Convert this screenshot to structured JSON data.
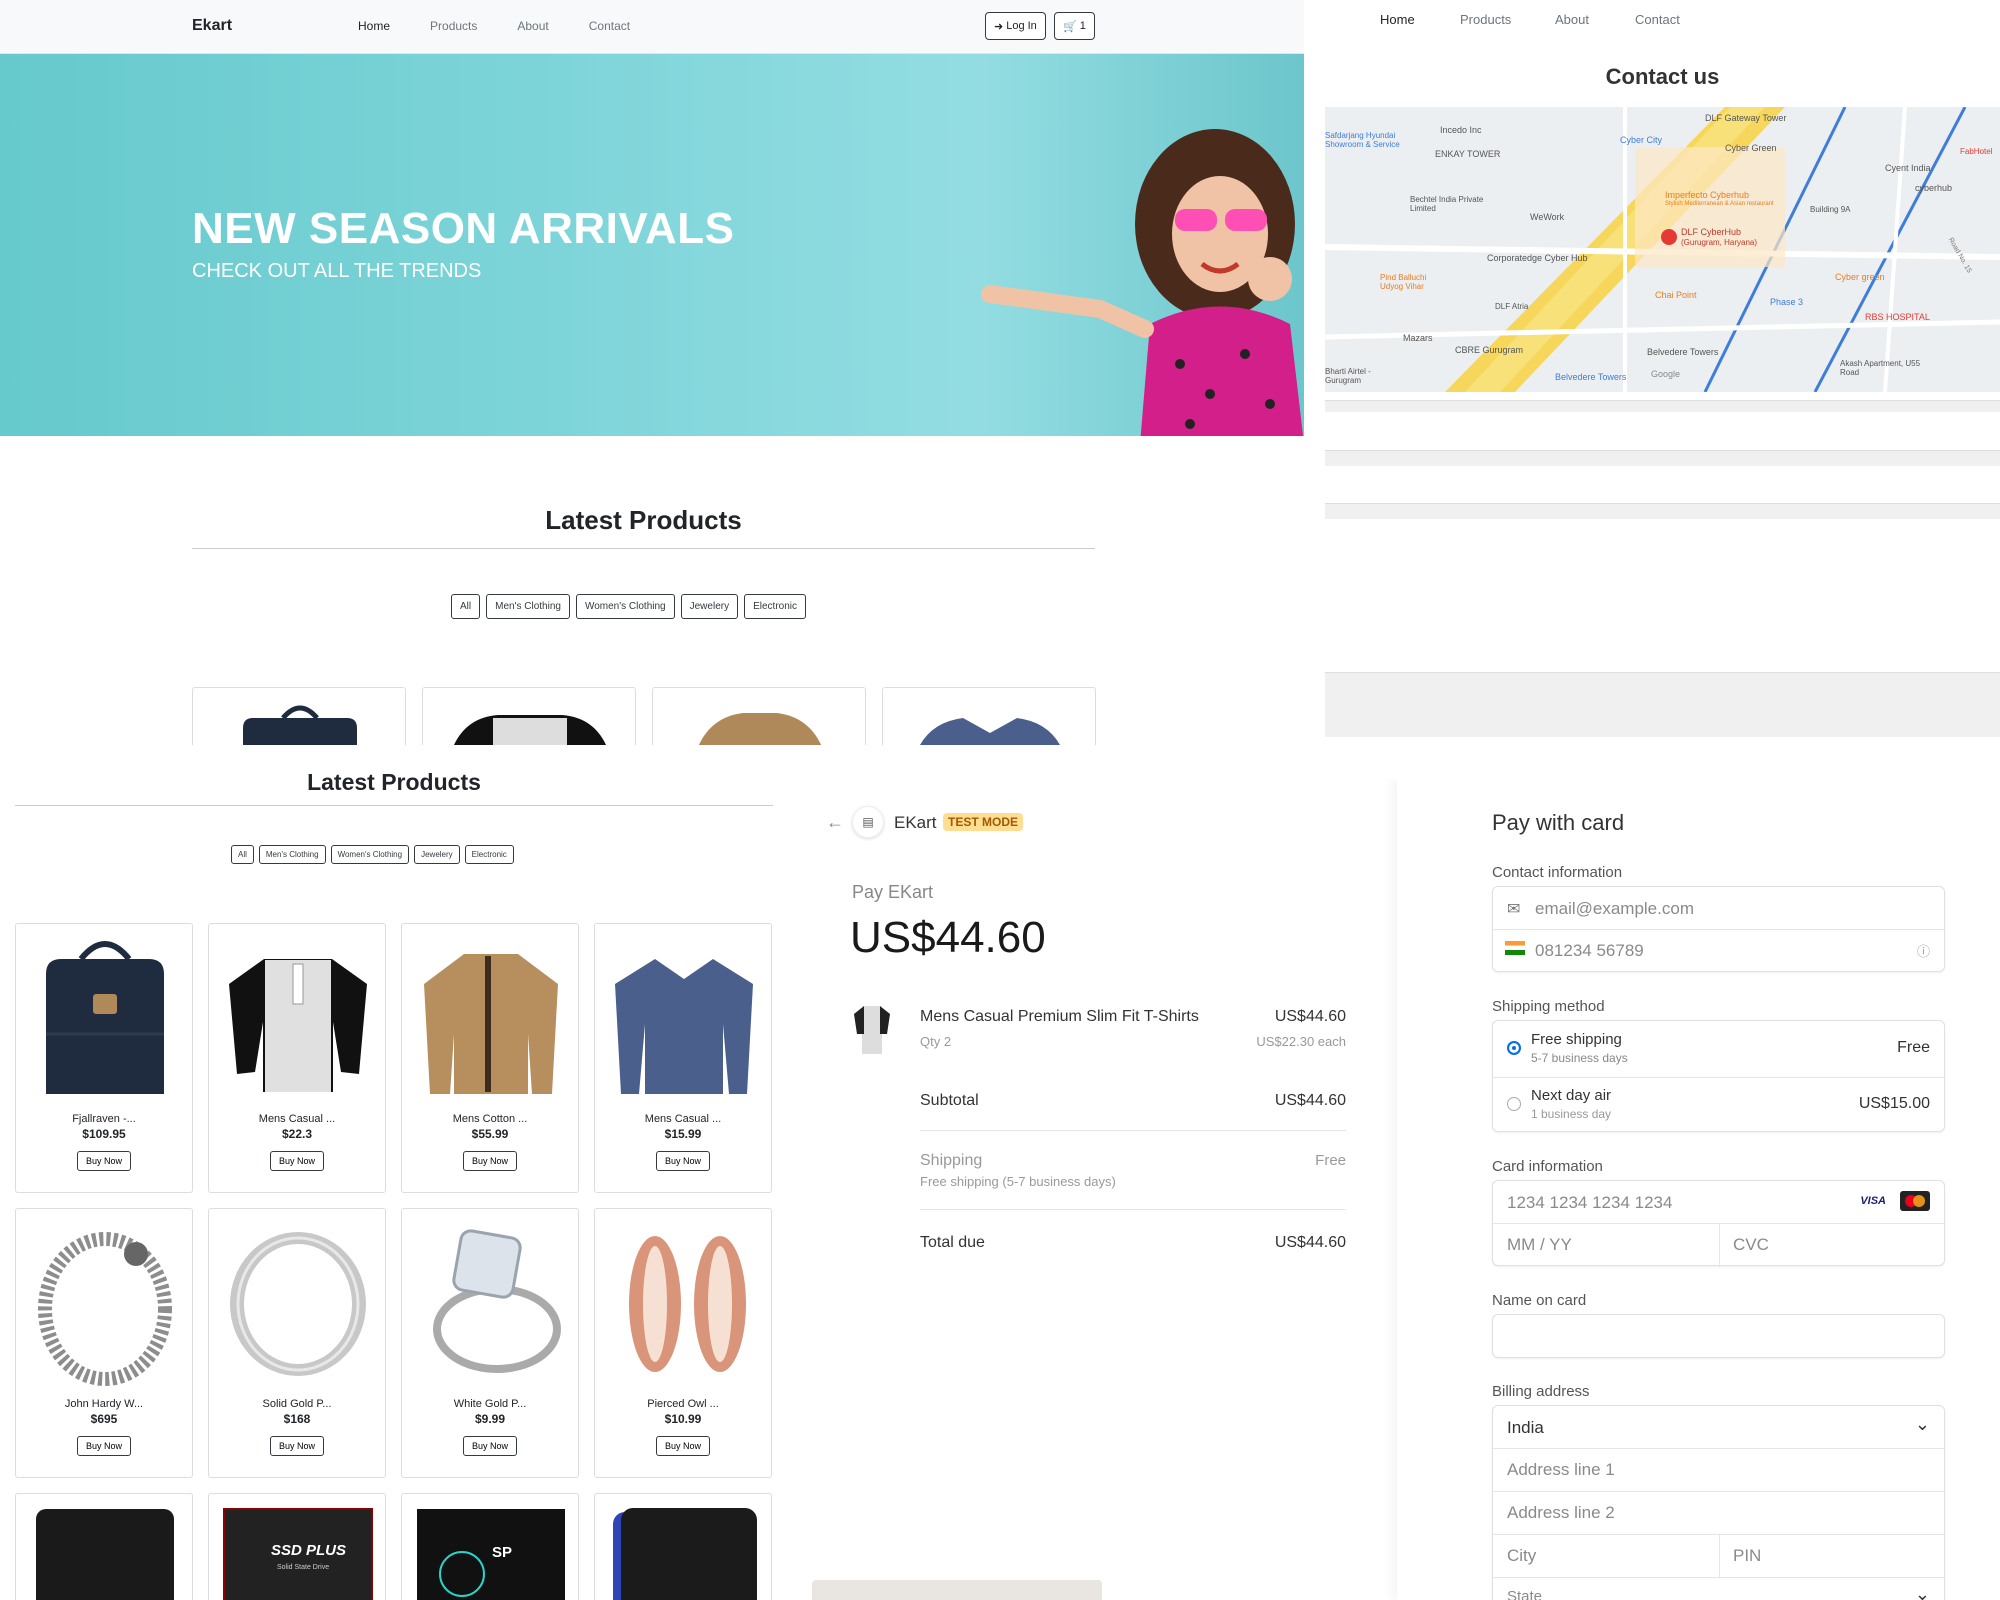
{
  "home": {
    "brand": "Ekart",
    "nav": [
      "Home",
      "Products",
      "About",
      "Contact"
    ],
    "login_label": "Log In",
    "cart_count": "1",
    "hero_title": "NEW SEASON ARRIVALS",
    "hero_subtitle": "CHECK OUT ALL THE TRENDS",
    "section_title": "Latest Products",
    "filters": [
      "All",
      "Men's Clothing",
      "Women's Clothing",
      "Jewelery",
      "Electronic"
    ]
  },
  "contact": {
    "nav": [
      "Home",
      "Products",
      "About",
      "Contact"
    ],
    "title": "Contact us",
    "map_labels": {
      "dlf_gateway": "DLF Gateway Tower",
      "cyber_city": "Cyber City",
      "cyber_green": "Cyber Green",
      "enkay": "ENKAY TOWER",
      "incedo": "Incedo Inc",
      "bechtel": "Bechtel India Private Limited",
      "wework": "WeWork",
      "imperfecto": "Imperfecto Cyberhub",
      "imperfecto_sub": "Stylish Mediterranean & Asian restaurant",
      "cyent": "Cyent India",
      "cyberhub": "cyberhub",
      "building9a": "Building 9A",
      "dlf_cyberhub": "DLF CyberHub",
      "dlf_cyberhub_sub": "(Gurugram, Haryana)",
      "corporatedge": "Corporatedge Cyber Hub",
      "chai_point": "Chai Point",
      "pind": "Pind Balluchi Udyog Vihar",
      "dlf_atria": "DLF Atria",
      "mazars": "Mazars",
      "cbre": "CBRE Gurugram",
      "belvedere": "Belvedere Towers",
      "belvedere2": "Belvedere Towers",
      "phase3": "Phase 3",
      "rbs": "RBS HOSPITAL",
      "cyber_green2": "Cyber green",
      "akash": "Akash Apartment, U55 Road",
      "bharti": "Bharti Airtel - Gurugram",
      "google": "Google",
      "fabhotel": "FabHotel",
      "safdarjang": "Safdarjang Hyundai Showroom & Service",
      "road": "Road No. 15"
    }
  },
  "products": {
    "section_title": "Latest Products",
    "filters": [
      "All",
      "Men's Clothing",
      "Women's Clothing",
      "Jewelery",
      "Electronic"
    ],
    "buy_label": "Buy Now",
    "items": [
      {
        "name": "Fjallraven -...",
        "price": "$109.95",
        "icon": "backpack-icon"
      },
      {
        "name": "Mens Casual ...",
        "price": "$22.3",
        "icon": "tshirt-icon"
      },
      {
        "name": "Mens Cotton ...",
        "price": "$55.99",
        "icon": "jacket-icon"
      },
      {
        "name": "Mens Casual ...",
        "price": "$15.99",
        "icon": "sweater-icon"
      },
      {
        "name": "John Hardy W...",
        "price": "$695",
        "icon": "bracelet-icon"
      },
      {
        "name": "Solid Gold P...",
        "price": "$168",
        "icon": "ring-icon"
      },
      {
        "name": "White Gold P...",
        "price": "$9.99",
        "icon": "diamond-ring-icon"
      },
      {
        "name": "Pierced Owl ...",
        "price": "$10.99",
        "icon": "earrings-icon"
      }
    ],
    "bottom_items": [
      {
        "icon": "hard-drive-icon",
        "label": ""
      },
      {
        "icon": "ssd-icon",
        "label": "SSD PLUS",
        "sub": "Solid State Drive"
      },
      {
        "icon": "ssd-sp-icon",
        "label": "SP"
      },
      {
        "icon": "wd-drive-icon",
        "label": ""
      }
    ]
  },
  "checkout": {
    "merchant": "EKart",
    "test_mode": "TEST MODE",
    "pay_label": "Pay EKart",
    "amount": "US$44.60",
    "item_name": "Mens Casual Premium Slim Fit T-Shirts",
    "item_price": "US$44.60",
    "item_qty": "Qty 2",
    "item_each": "US$22.30 each",
    "subtotal_label": "Subtotal",
    "subtotal": "US$44.60",
    "shipping_label": "Shipping",
    "shipping_value": "Free",
    "shipping_detail": "Free shipping (5-7 business days)",
    "total_label": "Total due",
    "total": "US$44.60",
    "form": {
      "title": "Pay with card",
      "contact_label": "Contact information",
      "email_placeholder": "email@example.com",
      "phone_placeholder": "081234 56789",
      "shipping_method_label": "Shipping method",
      "free_shipping": "Free shipping",
      "free_shipping_days": "5-7 business days",
      "free_shipping_price": "Free",
      "next_day": "Next day air",
      "next_day_days": "1 business day",
      "next_day_price": "US$15.00",
      "card_label": "Card information",
      "card_placeholder": "1234 1234 1234 1234",
      "visa": "VISA",
      "expiry_placeholder": "MM / YY",
      "cvc_placeholder": "CVC",
      "name_label": "Name on card",
      "billing_label": "Billing address",
      "country": "India",
      "address1": "Address line 1",
      "address2": "Address line 2",
      "city": "City",
      "pin": "PIN",
      "state": "State"
    }
  }
}
